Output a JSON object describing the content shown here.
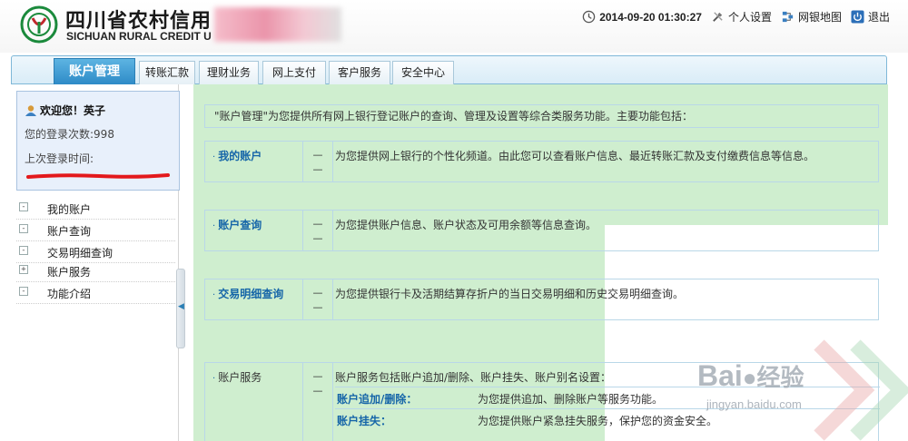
{
  "header": {
    "brand_cn": "四川省农村信用",
    "brand_en": "SICHUAN RURAL CREDIT U",
    "datetime": "2014-09-20 01:30:27",
    "links": {
      "settings": "个人设置",
      "sitemap": "网银地图",
      "logout": "退出"
    }
  },
  "nav": {
    "tabs": [
      {
        "label": "账户管理"
      },
      {
        "label": "转账汇款"
      },
      {
        "label": "理财业务"
      },
      {
        "label": "网上支付"
      },
      {
        "label": "客户服务"
      },
      {
        "label": "安全中心"
      }
    ]
  },
  "welcome": {
    "greeting": "欢迎您！英子",
    "login_count": "您的登录次数:998",
    "last_login_label": "上次登录时间:"
  },
  "sidebar": {
    "items": [
      {
        "toggle": "-",
        "label": "我的账户"
      },
      {
        "toggle": "-",
        "label": "账户查询"
      },
      {
        "toggle": "-",
        "label": "交易明细查询"
      },
      {
        "toggle": "+",
        "label": "账户服务"
      },
      {
        "toggle": "-",
        "label": "功能介绍"
      }
    ],
    "collapse_glyph": "◀"
  },
  "main": {
    "intro": "\"账户管理\"为您提供所有网上银行登记账户的查询、管理及设置等综合类服务功能。主要功能包括：",
    "dash": "—",
    "rows": [
      {
        "name": "我的账户",
        "desc": "为您提供网上银行的个性化频道。由此您可以查看账户信息、最近转账汇款及支付缴费信息等信息。"
      },
      {
        "name": "账户查询",
        "desc": "为您提供账户信息、账户状态及可用余额等信息查询。"
      },
      {
        "name": "交易明细查询",
        "desc": "为您提供银行卡及活期结算存折户的当日交易明细和历史交易明细查询。"
      },
      {
        "name": "账户服务",
        "desc": "账户服务包括账户追加/删除、账户挂失、账户别名设置：",
        "subs": [
          {
            "k": "账户追加/删除：",
            "v": "为您提供追加、删除账户等服务功能。"
          },
          {
            "k": "账户挂失：",
            "v": "为您提供账户紧急挂失服务，保护您的资金安全。"
          }
        ]
      }
    ]
  },
  "watermark": {
    "brand": "Bai",
    "brand_cn": "经验",
    "url": "jingyan.baidu.com"
  },
  "colors": {
    "accent": "#2c89c6",
    "link": "#1565a8",
    "highlight": "#cfeecf",
    "redaction": "#e3191c"
  }
}
